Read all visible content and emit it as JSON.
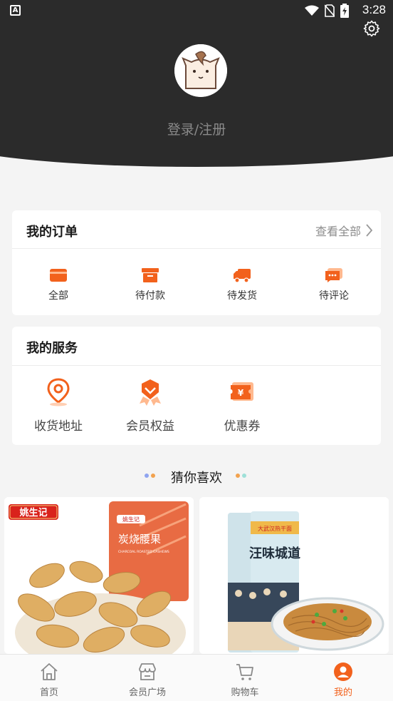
{
  "status_bar": {
    "time": "3:28",
    "indicator": "A"
  },
  "profile": {
    "login_label": "登录/注册"
  },
  "orders": {
    "title": "我的订单",
    "view_all": "查看全部",
    "items": [
      {
        "label": "全部",
        "icon": "wallet-icon"
      },
      {
        "label": "待付款",
        "icon": "box-icon"
      },
      {
        "label": "待发货",
        "icon": "truck-icon"
      },
      {
        "label": "待评论",
        "icon": "comment-icon"
      }
    ]
  },
  "services": {
    "title": "我的服务",
    "items": [
      {
        "label": "收货地址",
        "icon": "location-icon"
      },
      {
        "label": "会员权益",
        "icon": "badge-icon"
      },
      {
        "label": "优惠券",
        "icon": "coupon-icon"
      }
    ]
  },
  "recommend": {
    "title": "猜你喜欢",
    "products": [
      {
        "brand": "姚生记",
        "name": "炭烧腰果",
        "name_en": "CHARCOAL ROASTED CASHEWS"
      },
      {
        "brand": "大武汉热干面",
        "name": "汪味城道"
      }
    ]
  },
  "tabbar": {
    "items": [
      {
        "label": "首页",
        "icon": "home-icon"
      },
      {
        "label": "会员广场",
        "icon": "store-icon"
      },
      {
        "label": "购物车",
        "icon": "cart-icon"
      },
      {
        "label": "我的",
        "icon": "user-icon"
      }
    ],
    "active_index": 3
  },
  "colors": {
    "accent": "#f2611c",
    "header_bg": "#2b2b2b",
    "page_bg": "#f4f4f4"
  }
}
